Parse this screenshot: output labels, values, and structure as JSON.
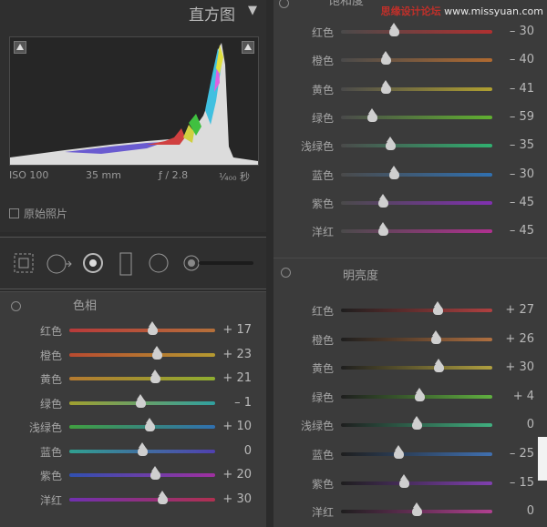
{
  "histogram": {
    "title": "直方图",
    "arrow": "▼",
    "iso": "ISO 100",
    "focal": "35 mm",
    "aperture": "ƒ / 2.8",
    "shutter": "¹⁄₄₀₀ 秒",
    "original_label": "原始照片"
  },
  "hue": {
    "title": "色相",
    "rows": [
      {
        "label": "红色",
        "value": "+ 17",
        "pos": 0.57,
        "c1": "#b83a3a",
        "c2": "#b5703a"
      },
      {
        "label": "橙色",
        "value": "+ 23",
        "pos": 0.6,
        "c1": "#b84a30",
        "c2": "#b59a30"
      },
      {
        "label": "黄色",
        "value": "+ 21",
        "pos": 0.59,
        "c1": "#b57a30",
        "c2": "#8fae30"
      },
      {
        "label": "绿色",
        "value": "– 1",
        "pos": 0.49,
        "c1": "#a0a030",
        "c2": "#30a0a0"
      },
      {
        "label": "浅绿色",
        "value": "+ 10",
        "pos": 0.55,
        "c1": "#40a040",
        "c2": "#3070b0"
      },
      {
        "label": "蓝色",
        "value": "0",
        "pos": 0.5,
        "c1": "#30a090",
        "c2": "#5040b0"
      },
      {
        "label": "紫色",
        "value": "+ 20",
        "pos": 0.59,
        "c1": "#3050b0",
        "c2": "#a030a0"
      },
      {
        "label": "洋红",
        "value": "+ 30",
        "pos": 0.64,
        "c1": "#7030b0",
        "c2": "#b03050"
      }
    ]
  },
  "saturation": {
    "title": "饱和度",
    "rows": [
      {
        "label": "红色",
        "value": "– 30",
        "pos": 0.35,
        "c1": "#4a4a4a",
        "c2": "#b03030"
      },
      {
        "label": "橙色",
        "value": "– 40",
        "pos": 0.3,
        "c1": "#4a4a4a",
        "c2": "#b06a30"
      },
      {
        "label": "黄色",
        "value": "– 41",
        "pos": 0.3,
        "c1": "#4a4a4a",
        "c2": "#b0a030"
      },
      {
        "label": "绿色",
        "value": "– 59",
        "pos": 0.21,
        "c1": "#4a4a4a",
        "c2": "#60b030"
      },
      {
        "label": "浅绿色",
        "value": "– 35",
        "pos": 0.33,
        "c1": "#4a4a4a",
        "c2": "#30b070"
      },
      {
        "label": "蓝色",
        "value": "– 30",
        "pos": 0.35,
        "c1": "#4a4a4a",
        "c2": "#3070b0"
      },
      {
        "label": "紫色",
        "value": "– 45",
        "pos": 0.28,
        "c1": "#4a4a4a",
        "c2": "#8030b0"
      },
      {
        "label": "洋红",
        "value": "– 45",
        "pos": 0.28,
        "c1": "#4a4a4a",
        "c2": "#b03090"
      }
    ]
  },
  "luminance": {
    "title": "明亮度",
    "rows": [
      {
        "label": "红色",
        "value": "+ 27",
        "pos": 0.64,
        "c1": "#1e1e1e",
        "c2": "#b04040"
      },
      {
        "label": "橙色",
        "value": "+ 26",
        "pos": 0.63,
        "c1": "#1e1e1e",
        "c2": "#b07040"
      },
      {
        "label": "黄色",
        "value": "+ 30",
        "pos": 0.65,
        "c1": "#1e1e1e",
        "c2": "#b0a040"
      },
      {
        "label": "绿色",
        "value": "+ 4",
        "pos": 0.52,
        "c1": "#1e1e1e",
        "c2": "#60b040"
      },
      {
        "label": "浅绿色",
        "value": "0",
        "pos": 0.5,
        "c1": "#1e1e1e",
        "c2": "#40b080"
      },
      {
        "label": "蓝色",
        "value": "– 25",
        "pos": 0.38,
        "c1": "#1e1e1e",
        "c2": "#4070b0"
      },
      {
        "label": "紫色",
        "value": "– 15",
        "pos": 0.42,
        "c1": "#1e1e1e",
        "c2": "#8040b0"
      },
      {
        "label": "洋红",
        "value": "0",
        "pos": 0.5,
        "c1": "#1e1e1e",
        "c2": "#b04090"
      }
    ]
  },
  "watermark": {
    "logo": "思缘设计论坛",
    "site": "www.missyuan.com"
  }
}
